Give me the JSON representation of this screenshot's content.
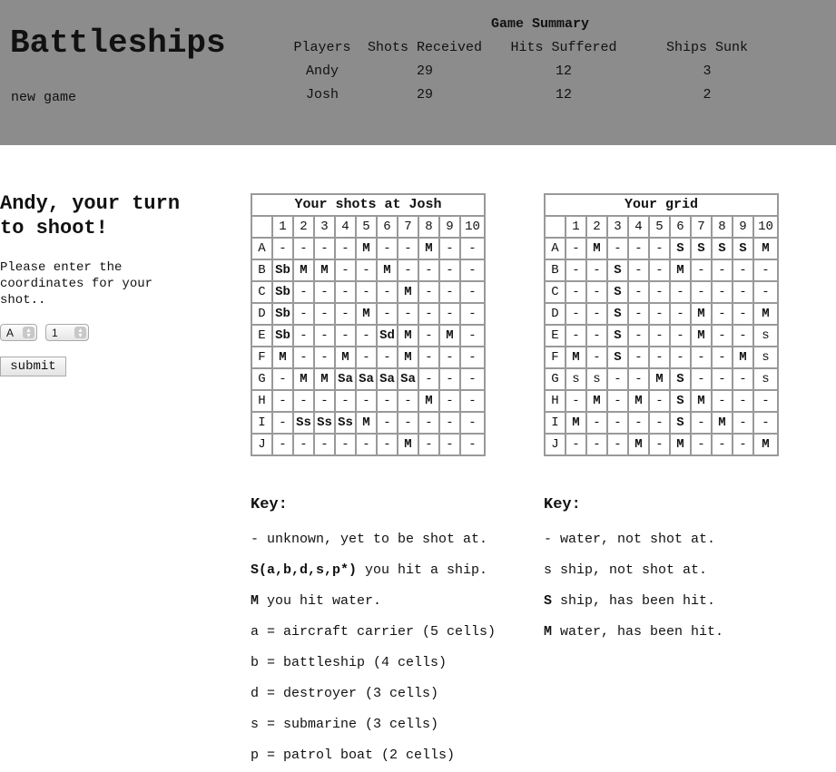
{
  "header": {
    "title": "Battleships",
    "new_game": "new game"
  },
  "summary": {
    "title": "Game Summary",
    "columns": [
      "Players",
      "Shots Received",
      "Hits Suffered",
      "Ships Sunk"
    ],
    "rows": [
      [
        "Andy",
        "29",
        "12",
        "3"
      ],
      [
        "Josh",
        "29",
        "12",
        "2"
      ]
    ]
  },
  "turn": {
    "line1": "Andy, your turn",
    "line2": "to shoot!",
    "instructions_line1": "Please enter the",
    "instructions_line2": "coordinates for your",
    "instructions_line3": "shot..",
    "row_select": "A",
    "col_select": "1",
    "submit": "submit",
    "arrow_icon": "up-down-arrows-icon"
  },
  "shots_grid": {
    "caption": "Your shots at Josh",
    "col_headers": [
      "1",
      "2",
      "3",
      "4",
      "5",
      "6",
      "7",
      "8",
      "9",
      "10"
    ],
    "rows": [
      {
        "label": "A",
        "cells": [
          "-",
          "-",
          "-",
          "-",
          "M",
          "-",
          "-",
          "M",
          "-",
          "-"
        ]
      },
      {
        "label": "B",
        "cells": [
          "Sb",
          "M",
          "M",
          "-",
          "-",
          "M",
          "-",
          "-",
          "-",
          "-"
        ]
      },
      {
        "label": "C",
        "cells": [
          "Sb",
          "-",
          "-",
          "-",
          "-",
          "-",
          "M",
          "-",
          "-",
          "-"
        ]
      },
      {
        "label": "D",
        "cells": [
          "Sb",
          "-",
          "-",
          "-",
          "M",
          "-",
          "-",
          "-",
          "-",
          "-"
        ]
      },
      {
        "label": "E",
        "cells": [
          "Sb",
          "-",
          "-",
          "-",
          "-",
          "Sd",
          "M",
          "-",
          "M",
          "-"
        ]
      },
      {
        "label": "F",
        "cells": [
          "M",
          "-",
          "-",
          "M",
          "-",
          "-",
          "M",
          "-",
          "-",
          "-"
        ]
      },
      {
        "label": "G",
        "cells": [
          "-",
          "M",
          "M",
          "Sa",
          "Sa",
          "Sa",
          "Sa",
          "-",
          "-",
          "-"
        ]
      },
      {
        "label": "H",
        "cells": [
          "-",
          "-",
          "-",
          "-",
          "-",
          "-",
          "-",
          "M",
          "-",
          "-"
        ]
      },
      {
        "label": "I",
        "cells": [
          "-",
          "Ss",
          "Ss",
          "Ss",
          "M",
          "-",
          "-",
          "-",
          "-",
          "-"
        ]
      },
      {
        "label": "J",
        "cells": [
          "-",
          "-",
          "-",
          "-",
          "-",
          "-",
          "M",
          "-",
          "-",
          "-"
        ]
      }
    ]
  },
  "own_grid": {
    "caption": "Your grid",
    "col_headers": [
      "1",
      "2",
      "3",
      "4",
      "5",
      "6",
      "7",
      "8",
      "9",
      "10"
    ],
    "rows": [
      {
        "label": "A",
        "cells": [
          "-",
          "M",
          "-",
          "-",
          "-",
          "S",
          "S",
          "S",
          "S",
          "M"
        ]
      },
      {
        "label": "B",
        "cells": [
          "-",
          "-",
          "S",
          "-",
          "-",
          "M",
          "-",
          "-",
          "-",
          "-"
        ]
      },
      {
        "label": "C",
        "cells": [
          "-",
          "-",
          "S",
          "-",
          "-",
          "-",
          "-",
          "-",
          "-",
          "-"
        ]
      },
      {
        "label": "D",
        "cells": [
          "-",
          "-",
          "S",
          "-",
          "-",
          "-",
          "M",
          "-",
          "-",
          "M"
        ]
      },
      {
        "label": "E",
        "cells": [
          "-",
          "-",
          "S",
          "-",
          "-",
          "-",
          "M",
          "-",
          "-",
          "s"
        ]
      },
      {
        "label": "F",
        "cells": [
          "M",
          "-",
          "S",
          "-",
          "-",
          "-",
          "-",
          "-",
          "M",
          "s"
        ]
      },
      {
        "label": "G",
        "cells": [
          "s",
          "s",
          "-",
          "-",
          "M",
          "S",
          "-",
          "-",
          "-",
          "s"
        ]
      },
      {
        "label": "H",
        "cells": [
          "-",
          "M",
          "-",
          "M",
          "-",
          "S",
          "M",
          "-",
          "-",
          "-"
        ]
      },
      {
        "label": "I",
        "cells": [
          "M",
          "-",
          "-",
          "-",
          "-",
          "S",
          "-",
          "M",
          "-",
          "-"
        ]
      },
      {
        "label": "J",
        "cells": [
          "-",
          "-",
          "-",
          "M",
          "-",
          "M",
          "-",
          "-",
          "-",
          "M"
        ]
      }
    ]
  },
  "key_left": {
    "title": "Key:",
    "items": [
      {
        "bold": "",
        "text": "- unknown, yet to be shot at."
      },
      {
        "bold": "S(a,b,d,s,p*)",
        "text": " you hit a ship."
      },
      {
        "bold": "M",
        "text": " you hit water."
      },
      {
        "bold": "",
        "text": "a = aircraft carrier (5 cells)"
      },
      {
        "bold": "",
        "text": "b = battleship (4 cells)"
      },
      {
        "bold": "",
        "text": "d = destroyer (3 cells)"
      },
      {
        "bold": "",
        "text": "s = submarine (3 cells)"
      },
      {
        "bold": "",
        "text": "p = patrol boat (2 cells)"
      }
    ]
  },
  "key_right": {
    "title": "Key:",
    "items": [
      {
        "bold": "",
        "text": "- water, not shot at."
      },
      {
        "bold": "",
        "text": "s ship, not shot at."
      },
      {
        "bold": "S",
        "text": " ship, has been hit."
      },
      {
        "bold": "M",
        "text": " water, has been hit."
      }
    ]
  }
}
